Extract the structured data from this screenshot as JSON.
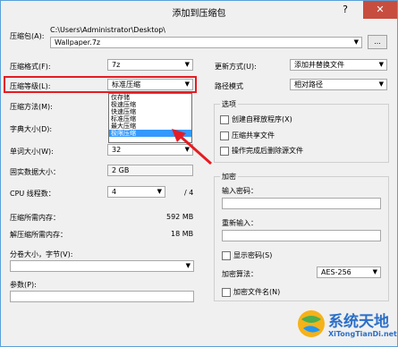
{
  "window": {
    "title": "添加到压缩包",
    "help": "?",
    "close": "✕"
  },
  "archive": {
    "label": "压缩包(A):",
    "path": "C:\\Users\\Administrator\\Desktop\\",
    "filename": "Wallpaper.7z",
    "browse": "..."
  },
  "left": {
    "format_label": "压缩格式(F):",
    "format_value": "7z",
    "level_label": "压缩等级(L):",
    "level_value": "标准压缩",
    "method_label": "压缩方法(M):",
    "dict_label": "字典大小(D):",
    "word_label": "单词大小(W):",
    "word_value": "32",
    "solid_label": "固实数据大小：",
    "solid_value": "2 GB",
    "threads_label": "CPU 线程数：",
    "threads_value": "4",
    "threads_total": "/ 4",
    "mem_compress_label": "压缩所需内存：",
    "mem_compress_value": "592 MB",
    "mem_decompress_label": "解压缩所需内存：",
    "mem_decompress_value": "18 MB",
    "volume_label": "分卷大小，字节(V):",
    "params_label": "参数(P):"
  },
  "level_options": [
    "仅存储",
    "极速压缩",
    "快速压缩",
    "标准压缩",
    "最大压缩",
    "极限压缩"
  ],
  "level_selected_index": 5,
  "right": {
    "update_label": "更新方式(U):",
    "update_value": "添加并替换文件",
    "path_label": "路径模式",
    "path_value": "相对路径",
    "options_title": "选项",
    "opt_sfx": "创建自释放程序(X)",
    "opt_share": "压缩共享文件",
    "opt_delete": "操作完成后删除源文件",
    "encrypt_title": "加密",
    "pw_label": "输入密码：",
    "pw2_label": "重新输入：",
    "show_pw": "显示密码(S)",
    "enc_method_label": "加密算法：",
    "enc_method_value": "AES-256",
    "enc_names": "加密文件名(N)"
  },
  "watermark": {
    "cn": "系统天地",
    "url": "XiTongTianDi.net"
  },
  "colors": {
    "highlight": "#3399ff",
    "annotation": "#e51c23",
    "close_button": "#c74d3f"
  }
}
